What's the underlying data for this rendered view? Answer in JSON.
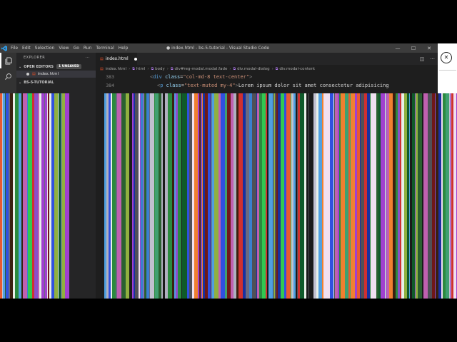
{
  "window": {
    "title": "● index.html - bs-5-tutorial - Visual Studio Code",
    "menu": [
      "File",
      "Edit",
      "Selection",
      "View",
      "Go",
      "Run",
      "Terminal",
      "Help"
    ],
    "controls": {
      "minimize": "—",
      "maximize": "☐",
      "close": "✕"
    }
  },
  "activity_bar": {
    "items": [
      "files-icon",
      "search-icon"
    ]
  },
  "sidebar": {
    "header": "EXPLORER",
    "header_menu": "···",
    "open_editors": {
      "label": "OPEN EDITORS",
      "badge": "1 UNSAVED",
      "files": [
        "index.html"
      ]
    },
    "project": {
      "label": "BS-5-TUTORIAL"
    }
  },
  "tabs": [
    {
      "label": "index.html",
      "modified": true
    }
  ],
  "breadcrumb": [
    "index.html",
    "html",
    "body",
    "div#reg-modal.modal.fade",
    "div.modal-dialog",
    "div.modal-content"
  ],
  "code": {
    "lines": [
      {
        "number": "383",
        "tag": "div",
        "attr": "class",
        "value": "\"col-md-8 text-center\"",
        "text": ""
      },
      {
        "number": "384",
        "tag": "p",
        "attr": "class",
        "value": "\"text-muted my-4\"",
        "text": "Lorem ipsum dolor sit amet consectetur adipisicing"
      }
    ]
  },
  "right_panel": {
    "close": "✕"
  },
  "colors": {
    "titlebar": "#3c3c3c",
    "activity": "#333333",
    "sidebar": "#252526",
    "editor": "#1e1e1e",
    "accent": "#007acc"
  }
}
